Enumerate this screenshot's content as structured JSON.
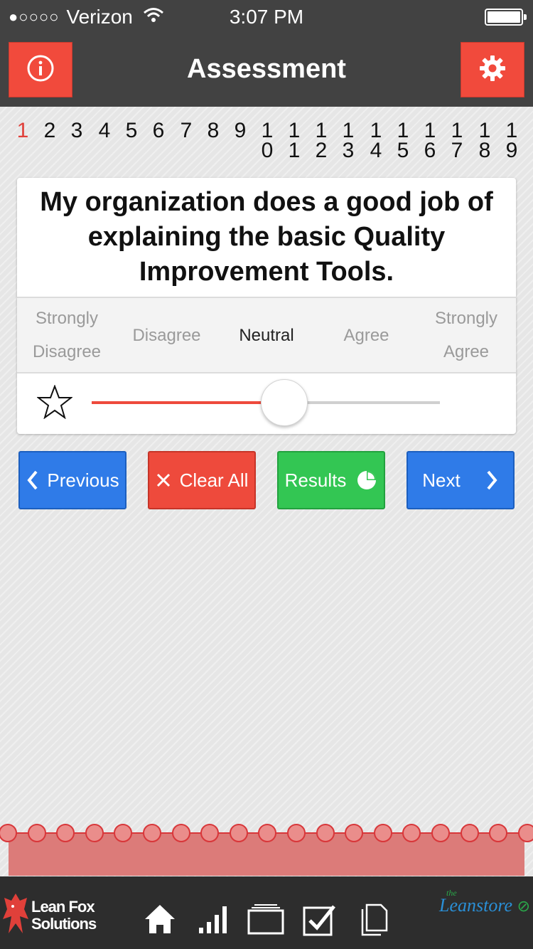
{
  "status_bar": {
    "carrier": "Verizon",
    "signal_dots": "●○○○○",
    "time": "3:07 PM"
  },
  "header": {
    "title": "Assessment"
  },
  "question_numbers": {
    "items": [
      "1",
      "2",
      "3",
      "4",
      "5",
      "6",
      "7",
      "8",
      "9",
      "10",
      "11",
      "12",
      "13",
      "14",
      "15",
      "16",
      "17",
      "18",
      "19"
    ],
    "active": "1"
  },
  "question": {
    "text": "My organization does a good job of explaining the basic Quality Improvement Tools."
  },
  "scale": {
    "options": [
      "Strongly Disagree",
      "Disagree",
      "Neutral",
      "Agree",
      "Strongly Agree"
    ],
    "selected": "Neutral"
  },
  "slider": {
    "value_fraction": 0.5
  },
  "buttons": {
    "previous": "Previous",
    "clear_all": "Clear All",
    "results": "Results",
    "next": "Next"
  },
  "footer": {
    "logo_line1": "Lean Fox",
    "logo_line2": "Solutions",
    "store_the": "the",
    "store_name": "Leanstore"
  },
  "colors": {
    "accent_red": "#ee4a3c",
    "blue": "#2f7be8",
    "green": "#33c653",
    "header_bg": "#424242"
  }
}
